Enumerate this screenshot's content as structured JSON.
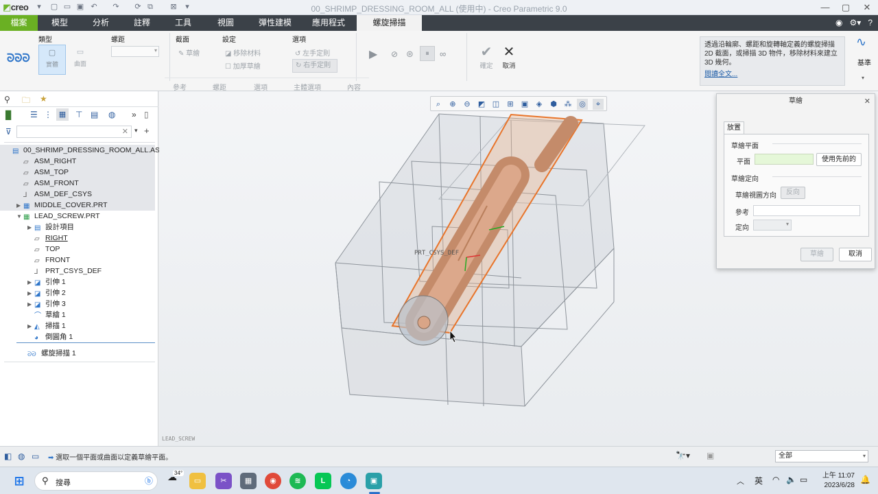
{
  "app": {
    "logo": "creo",
    "window_title": "00_SHRIMP_DRESSING_ROOM_ALL (使用中) - Creo Parametric 9.0"
  },
  "tabs": [
    "檔案",
    "模型",
    "分析",
    "註釋",
    "工具",
    "視圖",
    "彈性建模",
    "應用程式",
    "螺旋掃描"
  ],
  "ribbon": {
    "type_group": "類型",
    "type_solid": "實體",
    "type_surface": "曲面",
    "pitch_group": "螺距",
    "section_group": "截面",
    "section_sketch": "草繪",
    "settings_group": "設定",
    "remove_material": "移除材料",
    "thicken": "加厚草繪",
    "options_group": "選項",
    "left_hand": "左手定則",
    "right_hand": "右手定則",
    "ok": "確定",
    "cancel": "取消",
    "footer": [
      "參考",
      "螺距",
      "選項",
      "主體選項",
      "內容"
    ],
    "datum": "基準",
    "help_text": "透過沿輪廓、螺距和旋轉軸定義的螺旋掃描 2D 截面，或掃描 3D 物件，移除材料來建立 3D 幾何。",
    "help_link": "閱讀全文..."
  },
  "tree": [
    {
      "label": "00_SHRIMP_DRESSING_ROOM_ALL.ASM",
      "indent": 0,
      "sel": true,
      "tri": "",
      "icon": "asm"
    },
    {
      "label": "ASM_RIGHT",
      "indent": 1,
      "sel": true,
      "tri": "",
      "icon": "plane"
    },
    {
      "label": "ASM_TOP",
      "indent": 1,
      "sel": true,
      "tri": "",
      "icon": "plane"
    },
    {
      "label": "ASM_FRONT",
      "indent": 1,
      "sel": true,
      "tri": "",
      "icon": "plane"
    },
    {
      "label": "ASM_DEF_CSYS",
      "indent": 1,
      "sel": true,
      "tri": "",
      "icon": "csys"
    },
    {
      "label": "MIDDLE_COVER.PRT",
      "indent": 1,
      "sel": true,
      "tri": "▶",
      "icon": "part"
    },
    {
      "label": "LEAD_SCREW.PRT",
      "indent": 1,
      "sel": false,
      "tri": "▼",
      "icon": "partact"
    },
    {
      "label": "設計項目",
      "indent": 2,
      "sel": false,
      "tri": "▶",
      "icon": "design"
    },
    {
      "label": "RIGHT",
      "indent": 2,
      "sel": false,
      "tri": "",
      "icon": "plane",
      "ul": true
    },
    {
      "label": "TOP",
      "indent": 2,
      "sel": false,
      "tri": "",
      "icon": "plane"
    },
    {
      "label": "FRONT",
      "indent": 2,
      "sel": false,
      "tri": "",
      "icon": "plane"
    },
    {
      "label": "PRT_CSYS_DEF",
      "indent": 2,
      "sel": false,
      "tri": "",
      "icon": "csys"
    },
    {
      "label": "引伸 1",
      "indent": 2,
      "sel": false,
      "tri": "▶",
      "icon": "extrude"
    },
    {
      "label": "引伸 2",
      "indent": 2,
      "sel": false,
      "tri": "▶",
      "icon": "extrude"
    },
    {
      "label": "引伸 3",
      "indent": 2,
      "sel": false,
      "tri": "▶",
      "icon": "extrude"
    },
    {
      "label": "草繪 1",
      "indent": 2,
      "sel": false,
      "tri": "",
      "icon": "sketch"
    },
    {
      "label": "掃描 1",
      "indent": 2,
      "sel": false,
      "tri": "▶",
      "icon": "sweep"
    },
    {
      "label": "倒圓角 1",
      "indent": 2,
      "sel": false,
      "tri": "",
      "icon": "round"
    }
  ],
  "tree_active_feature": "螺旋掃描 1",
  "viewport": {
    "csys_label": "PRT_CSYS_DEF",
    "model_label": "LEAD_SCREW"
  },
  "dialog": {
    "title": "草繪",
    "tab": "放置",
    "sketch_plane_section": "草繪平面",
    "plane_label": "平面",
    "use_previous": "使用先前的",
    "orientation_section": "草繪定向",
    "view_direction": "草繪視圖方向",
    "flip": "反向",
    "reference": "參考",
    "orientation": "定向",
    "ok": "草繪",
    "cancel": "取消"
  },
  "status": {
    "message": "選取一個平面或曲面以定義草繪平面。",
    "filter": "全部"
  },
  "taskbar": {
    "search": "搜尋",
    "weather": "34°",
    "ime": "英",
    "time": "上午 11:07",
    "date": "2023/6/28"
  }
}
